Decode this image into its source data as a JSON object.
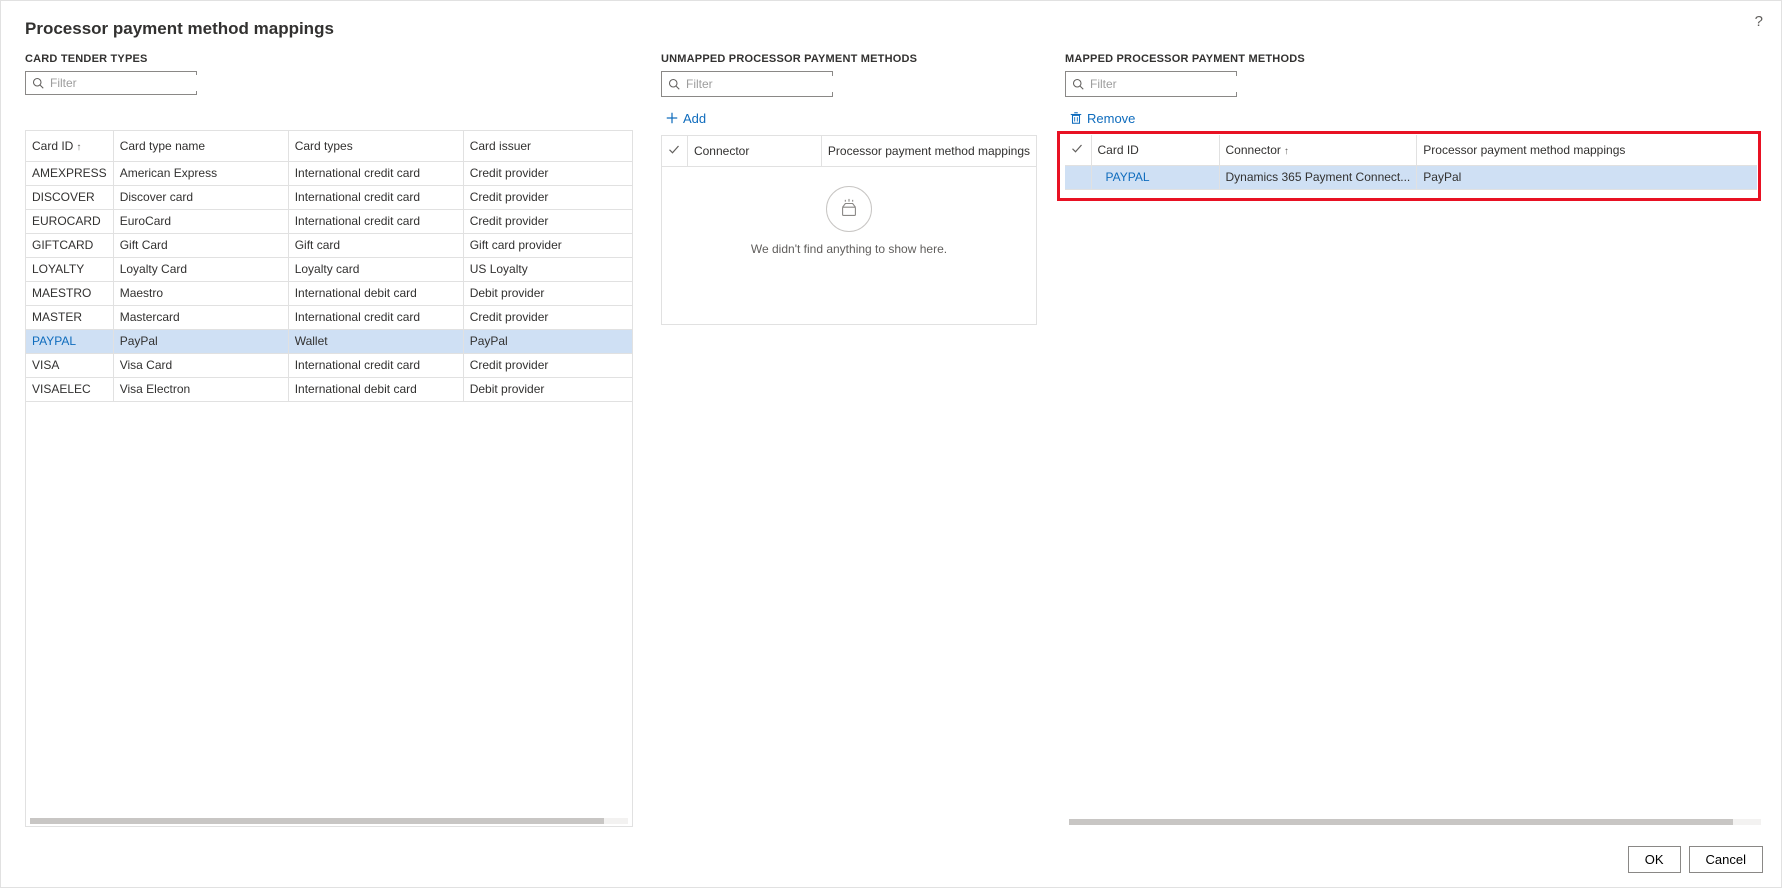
{
  "title": "Processor payment method mappings",
  "filters": {
    "placeholder": "Filter"
  },
  "tender": {
    "header": "CARD TENDER TYPES",
    "columns": [
      "Card ID",
      "Card type name",
      "Card types",
      "Card issuer"
    ],
    "sort_column": 0,
    "selected_index": 7,
    "rows": [
      {
        "id": "AMEXPRESS",
        "name": "American Express",
        "type": "International credit card",
        "issuer": "Credit provider"
      },
      {
        "id": "DISCOVER",
        "name": "Discover card",
        "type": "International credit card",
        "issuer": "Credit provider"
      },
      {
        "id": "EUROCARD",
        "name": "EuroCard",
        "type": "International credit card",
        "issuer": "Credit provider"
      },
      {
        "id": "GIFTCARD",
        "name": "Gift Card",
        "type": "Gift card",
        "issuer": "Gift card provider"
      },
      {
        "id": "LOYALTY",
        "name": "Loyalty Card",
        "type": "Loyalty card",
        "issuer": "US Loyalty"
      },
      {
        "id": "MAESTRO",
        "name": "Maestro",
        "type": "International debit card",
        "issuer": "Debit provider"
      },
      {
        "id": "MASTER",
        "name": "Mastercard",
        "type": "International credit card",
        "issuer": "Credit provider"
      },
      {
        "id": "PAYPAL",
        "name": "PayPal",
        "type": "Wallet",
        "issuer": "PayPal"
      },
      {
        "id": "VISA",
        "name": "Visa Card",
        "type": "International credit card",
        "issuer": "Credit provider"
      },
      {
        "id": "VISAELEC",
        "name": "Visa Electron",
        "type": "International debit card",
        "issuer": "Debit provider"
      }
    ]
  },
  "unmapped": {
    "header": "UNMAPPED PROCESSOR PAYMENT METHODS",
    "add_label": "Add",
    "columns": [
      "Connector",
      "Processor payment method mappings"
    ],
    "empty_message": "We didn't find anything to show here."
  },
  "mapped": {
    "header": "MAPPED PROCESSOR PAYMENT METHODS",
    "remove_label": "Remove",
    "columns": [
      "Card ID",
      "Connector",
      "Processor payment method mappings"
    ],
    "sort_column": 1,
    "rows": [
      {
        "card_id": "PAYPAL",
        "connector": "Dynamics 365 Payment Connect...",
        "mapping": "PayPal",
        "selected": true
      }
    ]
  },
  "footer": {
    "ok": "OK",
    "cancel": "Cancel"
  }
}
